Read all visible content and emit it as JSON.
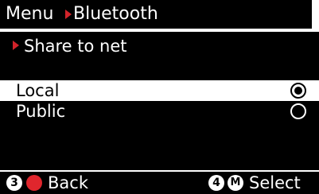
{
  "header": {
    "menu_label": "Menu",
    "page_title": "Bluetooth"
  },
  "section": {
    "title": "Share to net"
  },
  "options": [
    {
      "label": "Local",
      "selected": true
    },
    {
      "label": "Public",
      "selected": false
    }
  ],
  "footer": {
    "back_key": "3",
    "back_label": "Back",
    "select_key": "4",
    "select_icon_letter": "M",
    "select_label": "Select"
  },
  "colors": {
    "background": "#000000",
    "foreground": "#ffffff",
    "accent": "#d2232a"
  },
  "icons": {
    "breadcrumb_separator": "red-triangle-icon",
    "back_button": "record-icon",
    "select_button": "menu-m-icon"
  }
}
